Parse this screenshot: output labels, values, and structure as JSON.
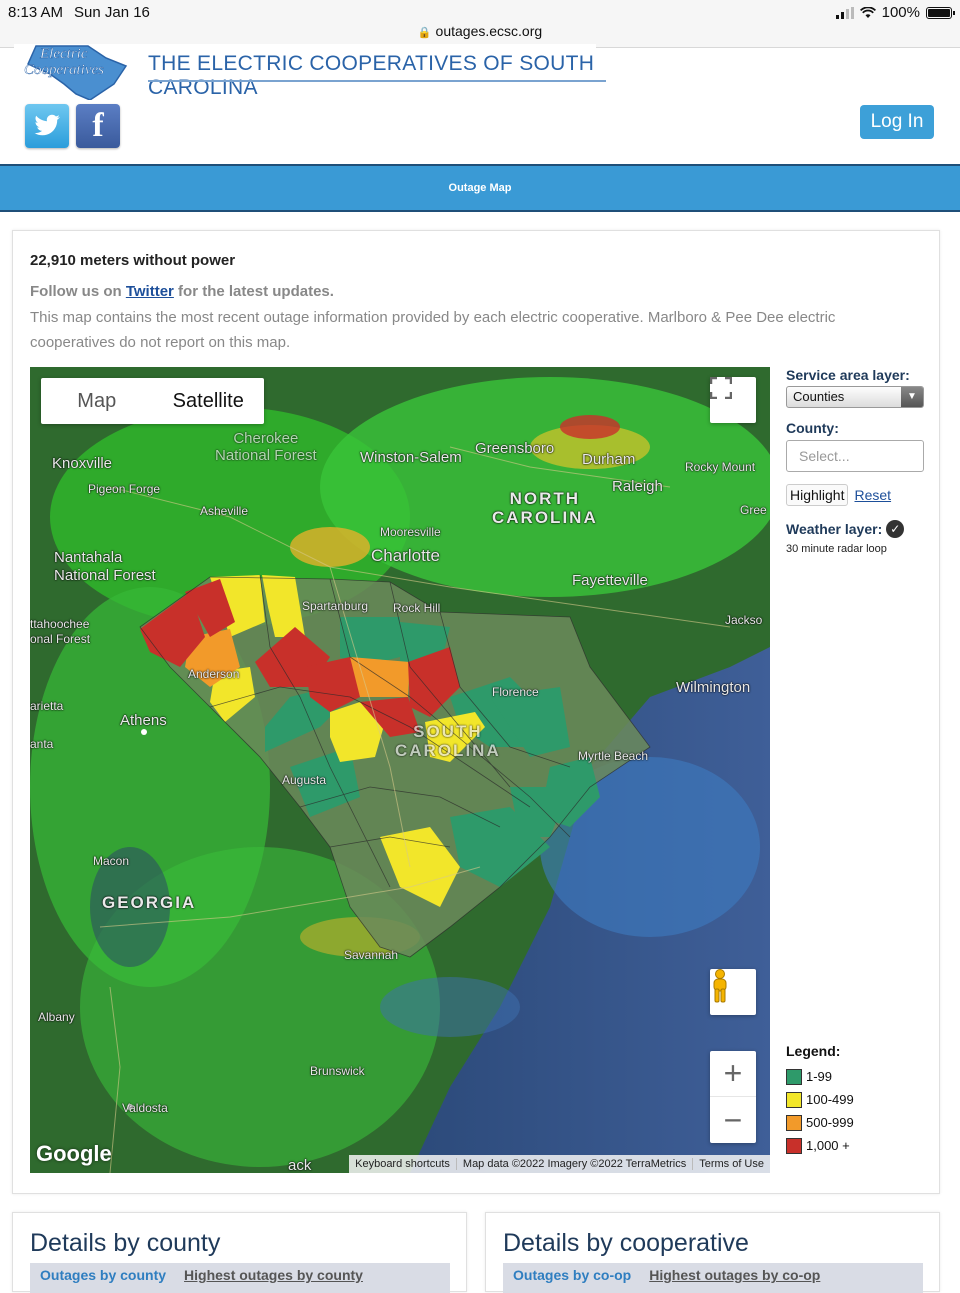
{
  "status": {
    "time": "8:13 AM",
    "date": "Sun Jan 16",
    "battery": "100%",
    "url": "outages.ecsc.org"
  },
  "header": {
    "logo_text": "THE ELECTRIC COOPERATIVES OF SOUTH CAROLINA",
    "logo_mark_text": "Electric Cooperatives",
    "login_label": "Log In"
  },
  "nav": {
    "item": "Outage Map"
  },
  "main": {
    "meters": "22,910 meters without power",
    "follow_prefix": "Follow us on ",
    "follow_link": "Twitter",
    "follow_suffix": " for the latest updates.",
    "description": "This map contains the most recent outage information provided by each electric cooperative. Marlboro & Pee Dee electric cooperatives do not report on this map."
  },
  "map": {
    "type_map": "Map",
    "type_satellite": "Satellite",
    "google": "Google",
    "attribution": [
      "Keyboard shortcuts",
      "Map data ©2022 Imagery ©2022 TerraMetrics",
      "Terms of Use"
    ],
    "labels": {
      "knoxville": "Knoxville",
      "pigeon_forge": "Pigeon Forge",
      "cherokee": "Cherokee\nNational Forest",
      "winston_salem": "Winston-Salem",
      "greensboro": "Greensboro",
      "durham": "Durham",
      "rocky_mount": "Rocky Mount",
      "raleigh": "Raleigh",
      "north_carolina": "NORTH\nCAROLINA",
      "asheville": "Asheville",
      "mooresville": "Mooresville",
      "charlotte": "Charlotte",
      "nantahala": "Nantahala\nNational Forest",
      "fayetteville": "Fayetteville",
      "spartanburg": "Spartanburg",
      "rock_hill": "Rock Hill",
      "chattahoochee": "ttahoochee\nonal Forest",
      "anderson": "Anderson",
      "florence": "Florence",
      "wilmington": "Wilmington",
      "marietta": "arietta",
      "athens": "Athens",
      "atlanta": "anta",
      "south_carolina": "SOUTH\nCAROLINA",
      "myrtle_beach": "Myrtle Beach",
      "augusta": "Augusta",
      "macon": "Macon",
      "georgia": "GEORGIA",
      "savannah": "Savannah",
      "albany": "Albany",
      "brunswick": "Brunswick",
      "valdosta": "Valdosta",
      "jackson": "Jackso",
      "green": "Gree",
      "jack_bottom": "ack"
    }
  },
  "side": {
    "service_label": "Service area layer:",
    "service_value": "Counties",
    "county_label": "County:",
    "county_placeholder": "Select...",
    "highlight": "Highlight",
    "reset": "Reset",
    "weather_label": "Weather layer:",
    "radar": "30 minute radar loop"
  },
  "legend": {
    "title": "Legend:",
    "items": [
      {
        "label": "1-99",
        "color": "#2e9a6a"
      },
      {
        "label": "100-499",
        "color": "#f2e62a"
      },
      {
        "label": "500-999",
        "color": "#f29a2a"
      },
      {
        "label": "1,000 +",
        "color": "#c8302a"
      }
    ]
  },
  "details": {
    "county_title": "Details by county",
    "county_tab1": "Outages by county",
    "county_tab2": "Highest outages by county",
    "coop_title": "Details by cooperative",
    "coop_tab1": "Outages by co-op",
    "coop_tab2": "Highest outages by co-op"
  }
}
